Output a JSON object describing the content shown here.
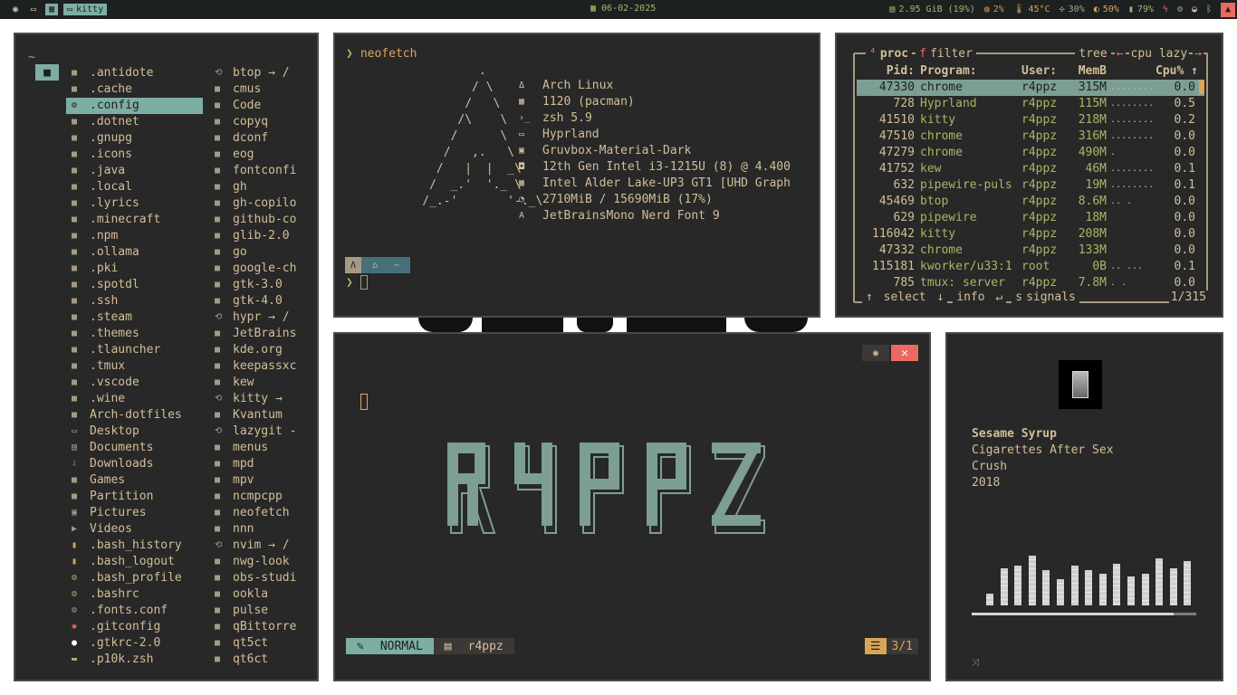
{
  "topbar": {
    "workspace_label": "kitty",
    "date": "06-02-2025",
    "memory": "2.95 GiB (19%)",
    "cpu": "2%",
    "temp": "45°C",
    "fan": "30%",
    "brightness": "50%",
    "battery": "79%"
  },
  "filemanager": {
    "path": "~",
    "col1": [
      {
        "name": ".antidote",
        "icon": "folder-icon"
      },
      {
        "name": ".cache",
        "icon": "folder-icon"
      },
      {
        "name": ".config",
        "icon": "gear-folder-icon",
        "selected": true
      },
      {
        "name": ".dotnet",
        "icon": "folder-icon"
      },
      {
        "name": ".gnupg",
        "icon": "folder-icon"
      },
      {
        "name": ".icons",
        "icon": "folder-icon"
      },
      {
        "name": ".java",
        "icon": "folder-icon"
      },
      {
        "name": ".local",
        "icon": "folder-icon"
      },
      {
        "name": ".lyrics",
        "icon": "folder-icon"
      },
      {
        "name": ".minecraft",
        "icon": "folder-icon"
      },
      {
        "name": ".npm",
        "icon": "folder-icon"
      },
      {
        "name": ".ollama",
        "icon": "folder-icon"
      },
      {
        "name": ".pki",
        "icon": "folder-icon"
      },
      {
        "name": ".spotdl",
        "icon": "folder-icon"
      },
      {
        "name": ".ssh",
        "icon": "folder-icon"
      },
      {
        "name": ".steam",
        "icon": "folder-icon"
      },
      {
        "name": ".themes",
        "icon": "folder-icon"
      },
      {
        "name": ".tlauncher",
        "icon": "folder-icon"
      },
      {
        "name": ".tmux",
        "icon": "folder-icon"
      },
      {
        "name": ".vscode",
        "icon": "folder-icon"
      },
      {
        "name": ".wine",
        "icon": "folder-icon"
      },
      {
        "name": "Arch-dotfiles",
        "icon": "folder-icon"
      },
      {
        "name": "Desktop",
        "icon": "desktop-icon"
      },
      {
        "name": "Documents",
        "icon": "documents-icon"
      },
      {
        "name": "Downloads",
        "icon": "download-icon"
      },
      {
        "name": "Games",
        "icon": "folder-icon"
      },
      {
        "name": "Partition",
        "icon": "folder-icon"
      },
      {
        "name": "Pictures",
        "icon": "pictures-icon"
      },
      {
        "name": "Videos",
        "icon": "video-icon"
      },
      {
        "name": ".bash_history",
        "icon": "file-icon",
        "color": "yellow"
      },
      {
        "name": ".bash_logout",
        "icon": "file-icon",
        "color": "yellow"
      },
      {
        "name": ".bash_profile",
        "icon": "gear-file-icon",
        "color": "green"
      },
      {
        "name": ".bashrc",
        "icon": "gear-file-icon",
        "color": "green"
      },
      {
        "name": ".fonts.conf",
        "icon": "gear-file-icon",
        "color": "fg"
      },
      {
        "name": ".gitconfig",
        "icon": "git-icon",
        "color": "red"
      },
      {
        "name": ".gtkrc-2.0",
        "icon": "circle-icon",
        "color": "white"
      },
      {
        "name": ".p10k.zsh",
        "icon": "terminal-file-icon",
        "color": "green"
      }
    ],
    "col2": [
      {
        "name": "btop → /",
        "icon": "link-icon"
      },
      {
        "name": "cmus",
        "icon": "folder-icon"
      },
      {
        "name": "Code",
        "icon": "folder-icon"
      },
      {
        "name": "copyq",
        "icon": "folder-icon"
      },
      {
        "name": "dconf",
        "icon": "folder-icon"
      },
      {
        "name": "eog",
        "icon": "folder-icon"
      },
      {
        "name": "fontconfi",
        "icon": "folder-icon"
      },
      {
        "name": "gh",
        "icon": "folder-icon"
      },
      {
        "name": "gh-copilo",
        "icon": "folder-icon"
      },
      {
        "name": "github-co",
        "icon": "folder-icon"
      },
      {
        "name": "glib-2.0",
        "icon": "folder-icon"
      },
      {
        "name": "go",
        "icon": "folder-icon"
      },
      {
        "name": "google-ch",
        "icon": "folder-icon"
      },
      {
        "name": "gtk-3.0",
        "icon": "folder-icon"
      },
      {
        "name": "gtk-4.0",
        "icon": "folder-icon"
      },
      {
        "name": "hypr → /",
        "icon": "link-icon"
      },
      {
        "name": "JetBrains",
        "icon": "folder-icon"
      },
      {
        "name": "kde.org",
        "icon": "folder-icon"
      },
      {
        "name": "keepassxc",
        "icon": "folder-icon"
      },
      {
        "name": "kew",
        "icon": "folder-icon"
      },
      {
        "name": "kitty →",
        "icon": "link-icon"
      },
      {
        "name": "Kvantum",
        "icon": "folder-icon"
      },
      {
        "name": "lazygit -",
        "icon": "link-icon"
      },
      {
        "name": "menus",
        "icon": "folder-icon"
      },
      {
        "name": "mpd",
        "icon": "folder-icon"
      },
      {
        "name": "mpv",
        "icon": "folder-icon"
      },
      {
        "name": "ncmpcpp",
        "icon": "folder-icon"
      },
      {
        "name": "neofetch",
        "icon": "folder-icon"
      },
      {
        "name": "nnn",
        "icon": "folder-icon"
      },
      {
        "name": "nvim → /",
        "icon": "link-icon"
      },
      {
        "name": "nwg-look",
        "icon": "folder-icon"
      },
      {
        "name": "obs-studi",
        "icon": "folder-icon"
      },
      {
        "name": "ookla",
        "icon": "folder-icon"
      },
      {
        "name": "pulse",
        "icon": "folder-icon"
      },
      {
        "name": "qBittorre",
        "icon": "folder-icon"
      },
      {
        "name": "qt5ct",
        "icon": "folder-icon"
      },
      {
        "name": "qt6ct",
        "icon": "folder-icon"
      }
    ]
  },
  "neofetch": {
    "command": "neofetch",
    "info": [
      {
        "icon": "arch-icon",
        "text": "Arch Linux"
      },
      {
        "icon": "package-icon",
        "text": "1120 (pacman)"
      },
      {
        "icon": "shell-icon",
        "text": "zsh 5.9"
      },
      {
        "icon": "monitor-icon",
        "text": "Hyprland"
      },
      {
        "icon": "palette-icon",
        "text": "Gruvbox-Material-Dark"
      },
      {
        "icon": "cpu-icon",
        "text": "12th Gen Intel i3-1215U (8) @ 4.400"
      },
      {
        "icon": "gpu-icon",
        "text": "Intel Alder Lake-UP3 GT1 [UHD Graph"
      },
      {
        "icon": "memory-icon",
        "text": "2710MiB / 15690MiB (17%)"
      },
      {
        "icon": "font-icon",
        "text": "JetBrainsMono Nerd Font 9"
      }
    ],
    "prompt_dir": "~"
  },
  "btop": {
    "header": {
      "proc": "proc",
      "filter": "filter",
      "tree": "tree",
      "cpu": "cpu lazy"
    },
    "columns": [
      "Pid:",
      "Program:",
      "User:",
      "MemB",
      "Cpu%"
    ],
    "rows": [
      {
        "pid": "47330",
        "prog": "chrome",
        "user": "r4ppz",
        "mem": "315M",
        "graph": "........",
        "cpu": "0.0",
        "selected": true
      },
      {
        "pid": "728",
        "prog": "Hyprland",
        "user": "r4ppz",
        "mem": "115M",
        "graph": "........",
        "cpu": "0.5"
      },
      {
        "pid": "41510",
        "prog": "kitty",
        "user": "r4ppz",
        "mem": "218M",
        "graph": "........",
        "cpu": "0.2"
      },
      {
        "pid": "47510",
        "prog": "chrome",
        "user": "r4ppz",
        "mem": "316M",
        "graph": "........",
        "cpu": "0.0"
      },
      {
        "pid": "47279",
        "prog": "chrome",
        "user": "r4ppz",
        "mem": "490M",
        "graph": ".",
        "cpu": "0.0"
      },
      {
        "pid": "41752",
        "prog": "kew",
        "user": "r4ppz",
        "mem": "46M",
        "graph": "........",
        "cpu": "0.1"
      },
      {
        "pid": "632",
        "prog": "pipewire-puls",
        "user": "r4ppz",
        "mem": "19M",
        "graph": "........",
        "cpu": "0.1"
      },
      {
        "pid": "45469",
        "prog": "btop",
        "user": "r4ppz",
        "mem": "8.6M",
        "graph": " .. .",
        "cpu": "0.0"
      },
      {
        "pid": "629",
        "prog": "pipewire",
        "user": "r4ppz",
        "mem": "18M",
        "graph": "",
        "cpu": "0.0"
      },
      {
        "pid": "116042",
        "prog": "kitty",
        "user": "r4ppz",
        "mem": "208M",
        "graph": "",
        "cpu": "0.0"
      },
      {
        "pid": "47332",
        "prog": "chrome",
        "user": "r4ppz",
        "mem": "133M",
        "graph": "",
        "cpu": "0.0"
      },
      {
        "pid": "115181",
        "prog": "kworker/u33:1",
        "user": "root",
        "mem": "0B",
        "graph": ".. ...",
        "cpu": "0.1"
      },
      {
        "pid": "785",
        "prog": "tmux: server",
        "user": "r4ppz",
        "mem": "7.8M",
        "graph": " .  .",
        "cpu": "0.0"
      }
    ],
    "footer": {
      "select": "select",
      "info": "info",
      "signals": "signals",
      "count": "1/315"
    }
  },
  "nvim": {
    "mode": "NORMAL",
    "file": "r4ppz",
    "position": "3/1",
    "logo_text": "R4PPZ"
  },
  "music": {
    "title": "Sesame Syrup",
    "artist": "Cigarettes After Sex",
    "album": "Crush",
    "year": "2018",
    "progress": 0.9,
    "visualizer": [
      0.22,
      0.7,
      0.75,
      0.95,
      0.68,
      0.5,
      0.75,
      0.68,
      0.6,
      0.8,
      0.55,
      0.6,
      0.9,
      0.7,
      0.85
    ]
  }
}
